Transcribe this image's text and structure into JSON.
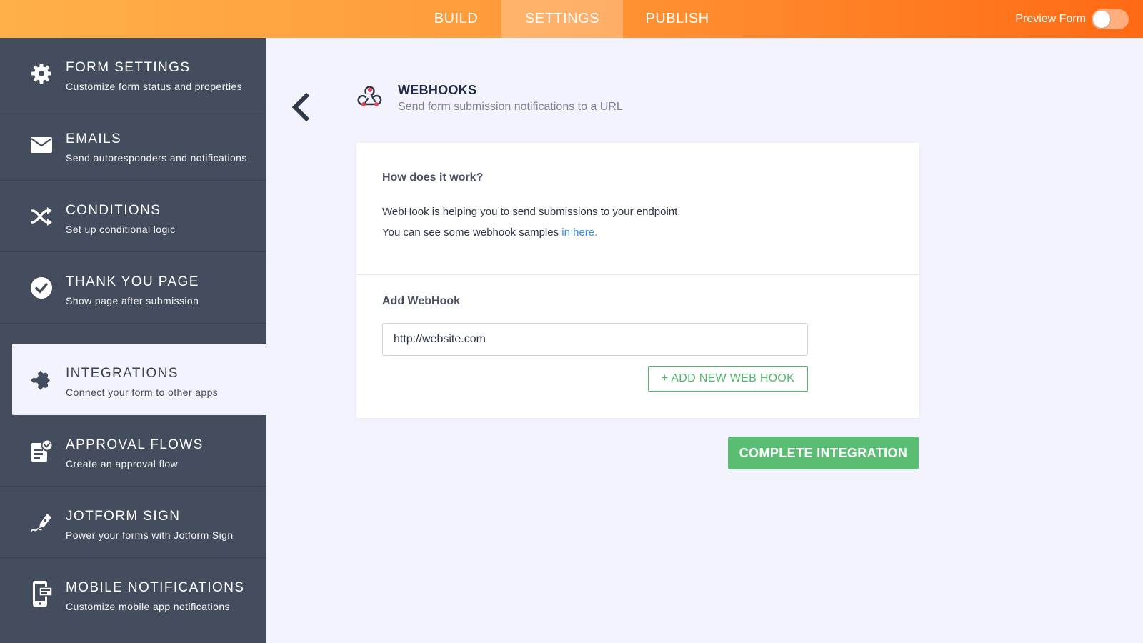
{
  "topbar": {
    "tabs": [
      {
        "label": "BUILD"
      },
      {
        "label": "SETTINGS",
        "active": true
      },
      {
        "label": "PUBLISH"
      }
    ],
    "preview_label": "Preview Form",
    "preview_toggle_on": false
  },
  "sidebar": {
    "items": [
      {
        "title": "FORM SETTINGS",
        "desc": "Customize form status and properties",
        "icon": "gear-icon"
      },
      {
        "title": "EMAILS",
        "desc": "Send autoresponders and notifications",
        "icon": "envelope-icon"
      },
      {
        "title": "CONDITIONS",
        "desc": "Set up conditional logic",
        "icon": "shuffle-icon"
      },
      {
        "title": "THANK YOU PAGE",
        "desc": "Show page after submission",
        "icon": "check-circle-icon"
      },
      {
        "title": "INTEGRATIONS",
        "desc": "Connect your form to other apps",
        "icon": "puzzle-icon",
        "active": true
      },
      {
        "title": "APPROVAL FLOWS",
        "desc": "Create an approval flow",
        "icon": "approval-icon"
      },
      {
        "title": "JOTFORM SIGN",
        "desc": "Power your forms with Jotform Sign",
        "icon": "pen-icon"
      },
      {
        "title": "MOBILE NOTIFICATIONS",
        "desc": "Customize mobile app notifications",
        "icon": "mobile-icon"
      }
    ]
  },
  "main": {
    "header": {
      "title": "WEBHOOKS",
      "subtitle": "Send form submission notifications to a URL",
      "icon": "webhook-icon"
    },
    "info": {
      "heading": "How does it work?",
      "line1": "WebHook is helping you to send submissions to your endpoint.",
      "line2_prefix": "You can see some webhook samples ",
      "line2_link": "in here."
    },
    "add": {
      "heading": "Add WebHook",
      "url_value": "http://website.com",
      "add_button": "+ ADD NEW WEB HOOK"
    },
    "complete_button": "COMPLETE INTEGRATION"
  },
  "colors": {
    "accent_orange": "#ff9a3a",
    "sidebar_bg": "#444d5e",
    "green": "#5bbd73",
    "link_blue": "#2a8ff7"
  }
}
